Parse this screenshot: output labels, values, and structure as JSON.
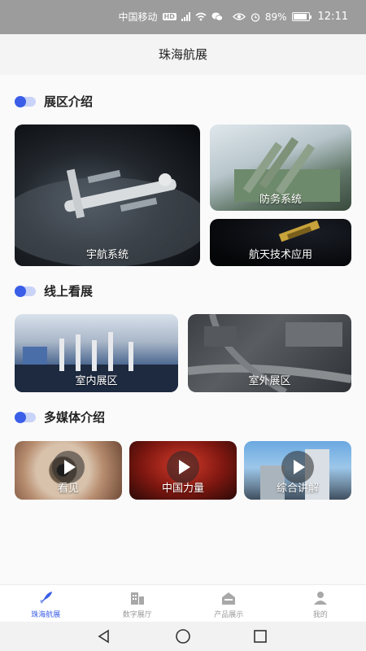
{
  "status_bar": {
    "carrier": "中国移动",
    "hd_badge": "HD",
    "battery": "89%",
    "battery_level": 0.89,
    "time": "12:11"
  },
  "header": {
    "title": "珠海航展"
  },
  "sections": {
    "exhibition": {
      "title": "展区介绍",
      "cards": [
        "宇航系统",
        "防务系统",
        "航天技术应用"
      ]
    },
    "online": {
      "title": "线上看展",
      "cards": [
        "室内展区",
        "室外展区"
      ]
    },
    "media": {
      "title": "多媒体介绍",
      "videos": [
        "看见",
        "中国力量",
        "综合讲解"
      ]
    }
  },
  "tabs": [
    {
      "label": "珠海航展",
      "icon": "rocket-icon",
      "active": true
    },
    {
      "label": "数字展厅",
      "icon": "building-icon",
      "active": false
    },
    {
      "label": "产品展示",
      "icon": "box-icon",
      "active": false
    },
    {
      "label": "我的",
      "icon": "user-icon",
      "active": false
    }
  ],
  "colors": {
    "accent": "#3b5ee8",
    "status_bar": "#9c9c9c",
    "tab_inactive": "#9a9a9a"
  }
}
